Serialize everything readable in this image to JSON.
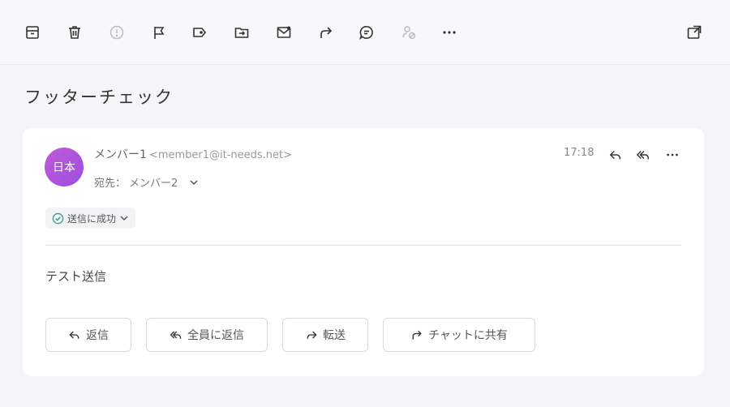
{
  "toolbar": {
    "icons": [
      "archive-icon",
      "trash-icon",
      "spam-icon",
      "flag-icon",
      "label-icon",
      "move-folder-icon",
      "mark-read-icon",
      "forward-share-icon",
      "chat-icon",
      "translate-icon",
      "more-icon",
      "open-window-icon"
    ]
  },
  "mail": {
    "subject": "フッターチェック",
    "sender_name": "メンバー1",
    "sender_email": "<member1@it-needs.net>",
    "avatar_text": "日本",
    "to_label": "宛先：",
    "to_name": "メンバー2",
    "time": "17:18",
    "status": "送信に成功",
    "body": "テスト送信"
  },
  "actions": {
    "reply": "返信",
    "reply_all": "全員に返信",
    "forward": "転送",
    "share_chat": "チャットに共有"
  },
  "colors": {
    "accent_avatar": "#a24fe0",
    "success": "#2a9d8f"
  }
}
